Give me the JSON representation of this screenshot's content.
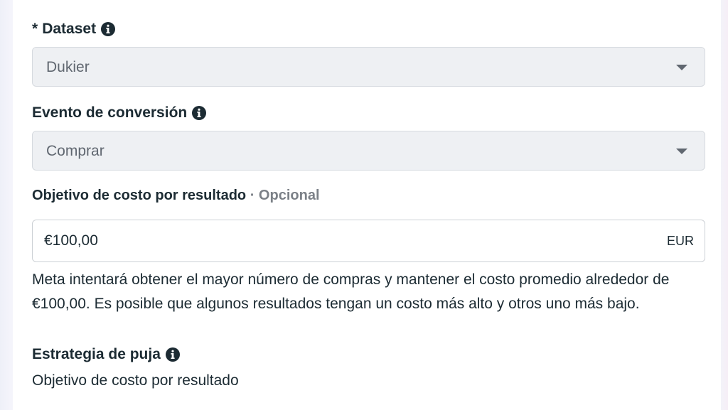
{
  "dataset": {
    "required_mark": "*",
    "label": "Dataset",
    "value": "Dukier"
  },
  "conversion_event": {
    "label": "Evento de conversión",
    "value": "Comprar"
  },
  "cost_goal": {
    "label": "Objetivo de costo por resultado",
    "optional": "· Opcional",
    "value": "€100,00",
    "currency": "EUR",
    "helper": "Meta intentará obtener el mayor número de compras y mantener el costo promedio alrededor de €100,00. Es posible que algunos resultados tengan un costo más alto y otros uno más bajo."
  },
  "bid_strategy": {
    "label": "Estrategia de puja",
    "value": "Objetivo de costo por resultado"
  },
  "icons": {
    "info": "info-circle-icon",
    "dropdown": "caret-down-icon"
  },
  "colors": {
    "text": "#1c2b33",
    "muted": "#606770",
    "disabled_bg": "#eef0f3",
    "border": "#ccd0d5"
  }
}
